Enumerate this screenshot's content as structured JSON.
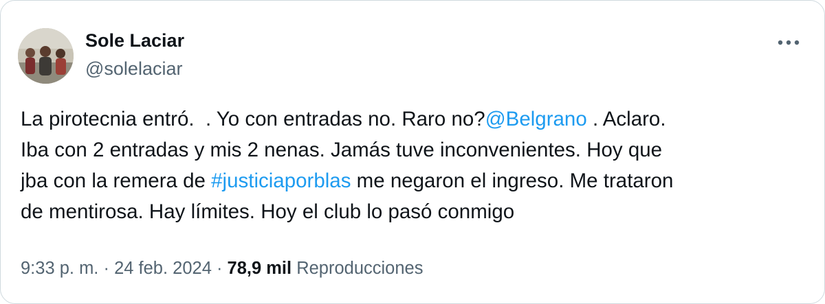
{
  "author": {
    "display_name": "Sole Laciar",
    "handle": "@solelaciar"
  },
  "more_icon": "ellipsis-horizontal-icon",
  "colors": {
    "text": "#0f1419",
    "secondary": "#536471",
    "link": "#1d9bf0",
    "border": "#cfd9de"
  },
  "tweet": {
    "line1_a": "La pirotecnia entró.  . Yo con entradas no. Raro no?",
    "mention": "@Belgrano",
    "line1_b": " . Aclaro.",
    "line2": "Iba con 2 entradas y mis 2 nenas. Jamás tuve inconvenientes. Hoy que",
    "line3_a": "jba con la remera de ",
    "hashtag": "#justiciaporblas",
    "line3_b": " me negaron el ingreso. Me trataron",
    "line4": "de mentirosa. Hay límites. Hoy el club lo pasó conmigo"
  },
  "meta": {
    "time": "9:33 p. m.",
    "separator": " · ",
    "date": "24 feb. 2024",
    "views_count": "78,9 mil",
    "views_label": "Reproducciones"
  }
}
